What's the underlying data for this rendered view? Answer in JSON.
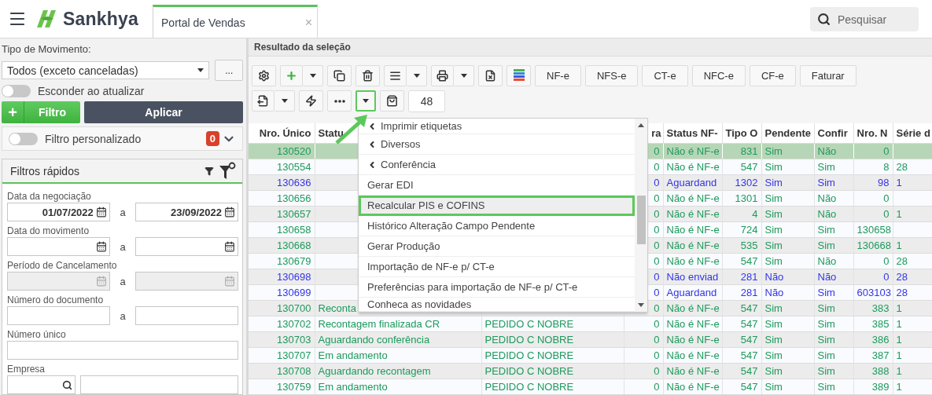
{
  "header": {
    "app_name": "Sankhya",
    "tab": {
      "label": "Portal de Vendas",
      "close": "×"
    },
    "search": {
      "placeholder": "Pesquisar"
    }
  },
  "filters": {
    "movement_type": {
      "label": "Tipo de Movimento:",
      "value": "Todos (exceto canceladas)",
      "more": "..."
    },
    "hide_on_update": {
      "label": "Esconder ao atualizar",
      "on": false
    },
    "add_filter": {
      "icon": "+",
      "label": "Filtro"
    },
    "apply": "Aplicar",
    "custom_filter": {
      "label": "Filtro personalizado",
      "on": false,
      "count": "0"
    }
  },
  "quick_filters": {
    "title": "Filtros rápidos",
    "fields": [
      {
        "kind": "daterange",
        "label": "Data da negociação",
        "from": "01/07/2022",
        "to": "23/09/2022",
        "separator": "a",
        "disabled": false
      },
      {
        "kind": "daterange",
        "label": "Data do movimento",
        "separator": "a",
        "disabled": false
      },
      {
        "kind": "daterange",
        "label": "Período de Cancelamento",
        "separator": "a",
        "disabled": true
      },
      {
        "kind": "range",
        "label": "Número do documento",
        "separator": "a"
      },
      {
        "kind": "single",
        "label": "Número único"
      },
      {
        "kind": "lookup",
        "label": "Empresa"
      }
    ]
  },
  "results": {
    "title": "Resultado da seleção",
    "toolbar": [
      [
        {
          "kind": "gear"
        },
        {
          "kind": "plus",
          "split": true
        },
        {
          "kind": "copy"
        },
        {
          "kind": "trash"
        },
        {
          "kind": "list",
          "split": true
        },
        {
          "kind": "print",
          "split": true
        },
        {
          "kind": "cancel"
        },
        {
          "kind": "bars"
        },
        {
          "kind": "text",
          "label": "NF-e"
        },
        {
          "kind": "text",
          "label": "NFS-e"
        },
        {
          "kind": "text",
          "label": "CT-e"
        },
        {
          "kind": "text",
          "label": "NFC-e"
        },
        {
          "kind": "text",
          "label": "CF-e"
        },
        {
          "kind": "text",
          "label": "Faturar"
        }
      ],
      [
        {
          "kind": "export",
          "split": true
        },
        {
          "kind": "bolt"
        },
        {
          "kind": "dots"
        },
        {
          "kind": "caret",
          "open": true
        },
        {
          "kind": "bag"
        },
        {
          "kind": "count",
          "label": "48"
        }
      ]
    ],
    "columns": [
      {
        "label": "Nro. Único"
      },
      {
        "label": "Statu"
      },
      {},
      {
        "label": "ra"
      },
      {
        "label": "Status NF-"
      },
      {
        "label": "Tipo O"
      },
      {
        "label": "Pendente"
      },
      {
        "label": "Confir"
      },
      {
        "label": "Nro. N"
      },
      {
        "label": "Série d"
      }
    ],
    "rows": [
      {
        "selected": true,
        "color": "#1e9a5c",
        "number": "130520",
        "column_4": "0",
        "nfe_status": "Não é NF-e",
        "type": "831",
        "pending": "Sim",
        "confirmed": "Não",
        "note_number": "0"
      },
      {
        "selected": false,
        "color": "#1e9a5c",
        "number": "130554",
        "column_4": "0",
        "nfe_status": "Não é NF-e",
        "type": "547",
        "pending": "Sim",
        "confirmed": "Sim",
        "note_number": "8",
        "series": "28"
      },
      {
        "selected": false,
        "color": "#3434e8",
        "number": "130636",
        "column_4": "0",
        "nfe_status": "Aguardand",
        "type": "1302",
        "pending": "Sim",
        "confirmed": "Sim",
        "note_number": "98",
        "series": "1"
      },
      {
        "selected": false,
        "color": "#1e9a5c",
        "number": "130656",
        "column_4": "0",
        "nfe_status": "Não é NF-e",
        "type": "1301",
        "pending": "Sim",
        "confirmed": "Não",
        "note_number": "0"
      },
      {
        "selected": false,
        "color": "#1e9a5c",
        "number": "130657",
        "column_4": "0",
        "nfe_status": "Não é NF-e",
        "type": "4",
        "pending": "Sim",
        "confirmed": "Não",
        "note_number": "0",
        "series": "1"
      },
      {
        "selected": false,
        "color": "#1e9a5c",
        "number": "130658",
        "column_4": "0",
        "nfe_status": "Não é NF-e",
        "type": "724",
        "pending": "Sim",
        "confirmed": "Sim",
        "note_number": "130658"
      },
      {
        "selected": false,
        "color": "#1e9a5c",
        "number": "130668",
        "column_4": "0",
        "nfe_status": "Não é NF-e",
        "type": "535",
        "pending": "Sim",
        "confirmed": "Sim",
        "note_number": "130668",
        "series": "1"
      },
      {
        "selected": false,
        "color": "#1e9a5c",
        "number": "130679",
        "column_4": "0",
        "nfe_status": "Não é NF-e",
        "type": "547",
        "pending": "Sim",
        "confirmed": "Não",
        "note_number": "0",
        "series": "28"
      },
      {
        "selected": false,
        "color": "#3434e8",
        "number": "130698",
        "column_4": "0",
        "nfe_status": "Não enviad",
        "type": "281",
        "pending": "Não",
        "confirmed": "Não",
        "note_number": "0",
        "series": "28"
      },
      {
        "selected": false,
        "color": "#3434e8",
        "number": "130699",
        "column_4": "0",
        "nfe_status": "Aguardand",
        "type": "281",
        "pending": "Não",
        "confirmed": "Sim",
        "note_number": "603103",
        "series": "28"
      },
      {
        "selected": false,
        "color": "#1e9a5c",
        "number": "130700",
        "status": "Reconta",
        "column_4": "0",
        "nfe_status": "Não é NF-e",
        "type": "547",
        "pending": "Sim",
        "confirmed": "Sim",
        "note_number": "383",
        "series": "1"
      },
      {
        "selected": false,
        "color": "#1e9a5c",
        "number": "130702",
        "status": "Recontagem finalizada CR",
        "column_3": "PEDIDO C NOBRE",
        "column_4": "0",
        "nfe_status": "Não é NF-e",
        "type": "547",
        "pending": "Sim",
        "confirmed": "Sim",
        "note_number": "385",
        "series": "1"
      },
      {
        "selected": false,
        "color": "#1e9a5c",
        "number": "130703",
        "status": "Aguardando conferência",
        "column_3": "PEDIDO C NOBRE",
        "column_4": "0",
        "nfe_status": "Não é NF-e",
        "type": "547",
        "pending": "Sim",
        "confirmed": "Sim",
        "note_number": "386",
        "series": "1"
      },
      {
        "selected": false,
        "color": "#1e9a5c",
        "number": "130707",
        "status": "Em andamento",
        "column_3": "PEDIDO C NOBRE",
        "column_4": "0",
        "nfe_status": "Não é NF-e",
        "type": "547",
        "pending": "Sim",
        "confirmed": "Sim",
        "note_number": "387",
        "series": "1"
      },
      {
        "selected": false,
        "color": "#1e9a5c",
        "number": "130708",
        "status": "Aguardando recontagem",
        "column_3": "PEDIDO C NOBRE",
        "column_4": "0",
        "nfe_status": "Não é NF-e",
        "type": "547",
        "pending": "Sim",
        "confirmed": "Sim",
        "note_number": "388",
        "series": "1"
      },
      {
        "selected": false,
        "color": "#1e9a5c",
        "number": "130759",
        "status": "Em andamento",
        "column_3": "PEDIDO C NOBRE",
        "column_4": "0",
        "nfe_status": "Não é NF-e",
        "type": "547",
        "pending": "Sim",
        "confirmed": "Sim",
        "note_number": "389",
        "series": "1"
      }
    ],
    "menu": {
      "items": [
        {
          "kind": "submenu",
          "label": "Imprimir etiquetas",
          "highlighted": false
        },
        {
          "kind": "submenu",
          "label": "Diversos",
          "highlighted": false
        },
        {
          "kind": "submenu",
          "label": "Conferência",
          "highlighted": false
        },
        {
          "kind": "action",
          "label": "Gerar EDI",
          "highlighted": false
        },
        {
          "kind": "action",
          "label": "Recalcular PIS e COFINS",
          "highlighted": true
        },
        {
          "kind": "action",
          "label": "Histórico Alteração Campo Pendente",
          "highlighted": false
        },
        {
          "kind": "action",
          "label": "Gerar Produção",
          "highlighted": false
        },
        {
          "kind": "action",
          "label": "Importação de NF-e p/ CT-e",
          "highlighted": false
        },
        {
          "kind": "action",
          "label": "Preferências para importação de NF-e p/ CT-e",
          "highlighted": false
        },
        {
          "kind": "action",
          "label": "Conheca as novidades",
          "highlighted": false
        }
      ]
    }
  }
}
